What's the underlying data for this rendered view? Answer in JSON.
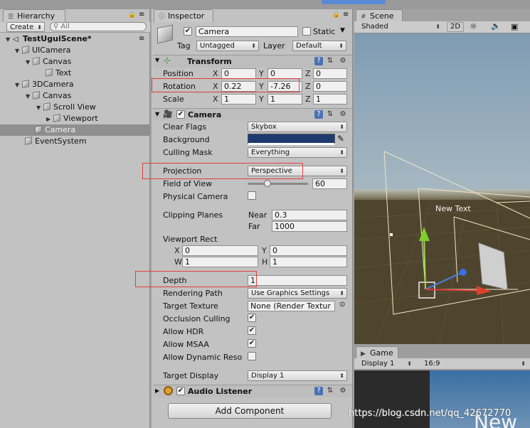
{
  "hierarchy": {
    "tab_label": "Hierarchy",
    "create_label": "Create",
    "search_placeholder": "All",
    "scene_name": "TestUguiScene*",
    "items": [
      {
        "label": "UICamera"
      },
      {
        "label": "Canvas"
      },
      {
        "label": "Text"
      },
      {
        "label": "3DCamera"
      },
      {
        "label": "Canvas"
      },
      {
        "label": "Scroll View"
      },
      {
        "label": "Viewport"
      },
      {
        "label": "Camera"
      },
      {
        "label": "EventSystem"
      }
    ]
  },
  "inspector": {
    "tab_label": "Inspector",
    "object_name": "Camera",
    "static_label": "Static",
    "tag_label": "Tag",
    "tag_value": "Untagged",
    "layer_label": "Layer",
    "layer_value": "Default",
    "transform": {
      "title": "Transform",
      "position_label": "Position",
      "rotation_label": "Rotation",
      "scale_label": "Scale",
      "x": "X",
      "y": "Y",
      "z": "Z",
      "position": [
        "0",
        "0",
        "0"
      ],
      "rotation": [
        "0.22",
        "-7.26",
        "0"
      ],
      "scale": [
        "1",
        "1",
        "1"
      ]
    },
    "camera": {
      "title": "Camera",
      "clear_flags_label": "Clear Flags",
      "clear_flags_value": "Skybox",
      "background_label": "Background",
      "background_color": "#1f3a6e",
      "culling_mask_label": "Culling Mask",
      "culling_mask_value": "Everything",
      "projection_label": "Projection",
      "projection_value": "Perspective",
      "fov_label": "Field of View",
      "fov_value": "60",
      "fov_fraction": 0.33,
      "physical_label": "Physical Camera",
      "clipping_label": "Clipping Planes",
      "near_label": "Near",
      "near_value": "0.3",
      "far_label": "Far",
      "far_value": "1000",
      "viewport_label": "Viewport Rect",
      "vx_label": "X",
      "vx_value": "0",
      "vy_label": "Y",
      "vy_value": "0",
      "vw_label": "W",
      "vw_value": "1",
      "vh_label": "H",
      "vh_value": "1",
      "depth_label": "Depth",
      "depth_value": "1",
      "rendering_path_label": "Rendering Path",
      "rendering_path_value": "Use Graphics Settings",
      "target_texture_label": "Target Texture",
      "target_texture_value": "None (Render Textur",
      "occlusion_label": "Occlusion Culling",
      "hdr_label": "Allow HDR",
      "msaa_label": "Allow MSAA",
      "dynres_label": "Allow Dynamic Reso",
      "target_display_label": "Target Display",
      "target_display_value": "Display 1"
    },
    "audio_listener_title": "Audio Listener",
    "add_component_label": "Add Component"
  },
  "scene": {
    "tab_label": "Scene",
    "shading_value": "Shaded",
    "mode_2d_label": "2D",
    "new_text_label": "New Text",
    "sky_color": "#7f9bb3",
    "ground_color": "#4f452f"
  },
  "game": {
    "tab_label": "Game",
    "display_value": "Display 1",
    "aspect_value": "16:9",
    "overlay_text": "New"
  },
  "watermark": "https://blog.csdn.net/qq_42672770",
  "colors": {
    "highlight": "#e33d3d",
    "selected_row": "#8f8f8f",
    "panel": "#c2c2c2"
  }
}
